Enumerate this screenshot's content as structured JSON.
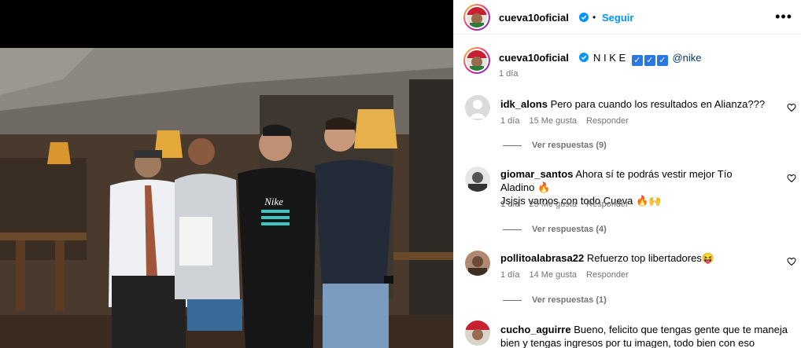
{
  "post": {
    "username": "cueva10oficial",
    "follow_label": "Seguir",
    "more_label": "•••",
    "separator": "•"
  },
  "caption": {
    "username": "cueva10oficial",
    "text": "N I K E",
    "checks": [
      "✓",
      "✓",
      "✓"
    ],
    "mention": "@nike",
    "time": "1 día"
  },
  "comments": [
    {
      "username": "idk_alons",
      "text": "Pero para cuando los resultados en Alianza???",
      "time": "1 día",
      "likes": "15 Me gusta",
      "reply": "Responder",
      "view_replies": "Ver respuestas (9)"
    },
    {
      "username": "giomar_santos",
      "text_line1": "Ahora sí te podrás vestir mejor Tío Aladino 🔥",
      "text_line2": "Jsjsjs vamos con todo Cueva 🔥🙌",
      "time": "1 día",
      "likes": "25 Me gusta",
      "reply": "Responder",
      "view_replies": "Ver respuestas (4)"
    },
    {
      "username": "pollitoalabrasa22",
      "text": "Refuerzo top libertadores😝",
      "time": "1 día",
      "likes": "14 Me gusta",
      "reply": "Responder",
      "view_replies": "Ver respuestas (1)"
    },
    {
      "username": "cucho_aguirre",
      "text_line1": "Bueno, felicito que tengas gente que te maneja",
      "text_line2": "bien y tengas ingresos por tu imagen, todo bien con eso"
    }
  ],
  "photo": {
    "shirt_text": "Nike"
  },
  "colors": {
    "accent": "#0095f6",
    "verified": "#0095f6",
    "secondary_text": "#737373",
    "mention": "#00376b"
  }
}
